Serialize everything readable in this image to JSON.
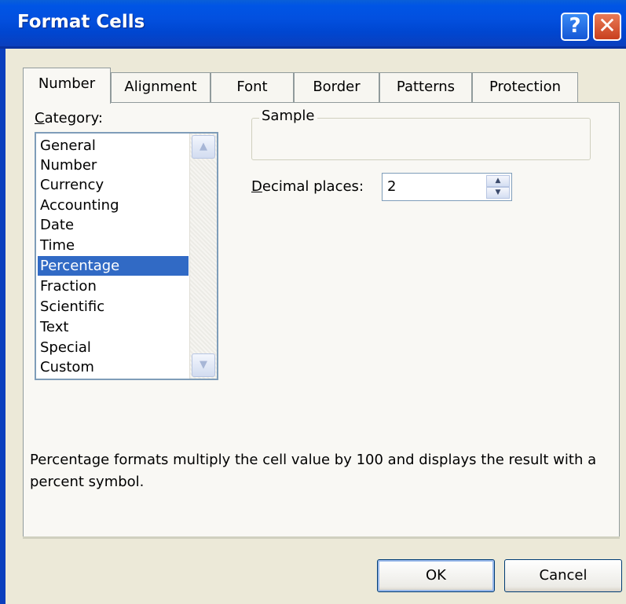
{
  "window": {
    "title": "Format Cells",
    "help_icon": "?",
    "close_icon": "✕"
  },
  "tabs": [
    {
      "label": "Number",
      "active": true
    },
    {
      "label": "Alignment",
      "active": false
    },
    {
      "label": "Font",
      "active": false
    },
    {
      "label": "Border",
      "active": false
    },
    {
      "label": "Patterns",
      "active": false
    },
    {
      "label": "Protection",
      "active": false
    }
  ],
  "category": {
    "label_underline": "C",
    "label_rest": "ategory:",
    "items": [
      "General",
      "Number",
      "Currency",
      "Accounting",
      "Date",
      "Time",
      "Percentage",
      "Fraction",
      "Scientific",
      "Text",
      "Special",
      "Custom"
    ],
    "selected": "Percentage"
  },
  "sample": {
    "legend": "Sample",
    "value": ""
  },
  "decimal_places": {
    "label_underline": "D",
    "label_rest": "ecimal places:",
    "value": "2"
  },
  "description": "Percentage formats multiply the cell value by 100 and displays the result with a percent symbol.",
  "buttons": {
    "ok": "OK",
    "cancel": "Cancel"
  },
  "colors": {
    "selection": "#316ac5",
    "titlebar": "#0055e5",
    "close": "#c9401f"
  }
}
